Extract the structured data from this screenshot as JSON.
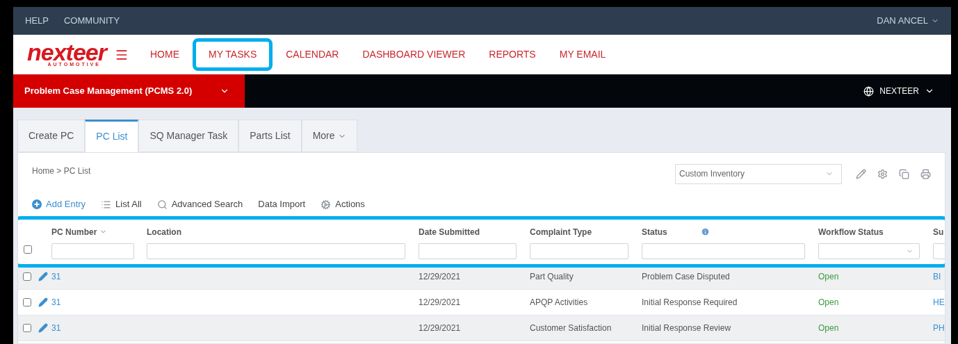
{
  "top_bar": {
    "links": [
      "HELP",
      "COMMUNITY"
    ],
    "user": "DAN ANCEL"
  },
  "logo": {
    "wordmark": "nexteer",
    "tagline": "AUTOMOTIVE"
  },
  "nav": [
    {
      "label": "HOME",
      "highlighted": false
    },
    {
      "label": "MY TASKS",
      "highlighted": true
    },
    {
      "label": "CALENDAR",
      "highlighted": false
    },
    {
      "label": "DASHBOARD VIEWER",
      "highlighted": false
    },
    {
      "label": "REPORTS",
      "highlighted": false
    },
    {
      "label": "MY EMAIL",
      "highlighted": false
    }
  ],
  "module_bar": {
    "title": "Problem Case Management (PCMS 2.0)",
    "org": "NEXTEER"
  },
  "tabs": [
    {
      "label": "Create PC",
      "selected": false,
      "kind": "tab"
    },
    {
      "label": "PC List",
      "selected": true,
      "kind": "tab"
    },
    {
      "label": "SQ Manager Task",
      "selected": false,
      "kind": "tab"
    },
    {
      "label": "Parts List",
      "selected": false,
      "kind": "tab"
    },
    {
      "label": "More",
      "selected": false,
      "kind": "dropdown"
    }
  ],
  "breadcrumb": "Home > PC List",
  "view_select": {
    "value": "Custom Inventory"
  },
  "toolbar": [
    {
      "label": "Add Entry",
      "kind": "add"
    },
    {
      "label": "List All",
      "kind": "list"
    },
    {
      "label": "Advanced Search",
      "kind": "search"
    },
    {
      "label": "Data Import",
      "kind": "plain"
    },
    {
      "label": "Actions",
      "kind": "actions"
    }
  ],
  "table": {
    "header_highlighted": true,
    "select_all_checked": false,
    "columns": [
      {
        "label": "PC Number",
        "kind": "text",
        "sort": true,
        "info": false
      },
      {
        "label": "Location",
        "kind": "text",
        "sort": false,
        "info": false
      },
      {
        "label": "Date Submitted",
        "kind": "text",
        "sort": false,
        "info": false
      },
      {
        "label": "Complaint Type",
        "kind": "text",
        "sort": false,
        "info": false
      },
      {
        "label": "Status",
        "kind": "text",
        "sort": false,
        "info": true
      },
      {
        "label": "Workflow Status",
        "kind": "select",
        "sort": false,
        "info": false
      },
      {
        "label": "Su",
        "kind": "text",
        "sort": false,
        "info": false
      }
    ],
    "rows": [
      {
        "checked": false,
        "cells": [
          "31",
          "",
          "12/29/2021",
          "Part Quality",
          "Problem Case Disputed",
          "Open",
          "BI"
        ]
      },
      {
        "checked": false,
        "cells": [
          "31",
          "",
          "12/29/2021",
          "APQP Activities",
          "Initial Response Required",
          "Open",
          "HE"
        ]
      },
      {
        "checked": false,
        "cells": [
          "31",
          "",
          "12/29/2021",
          "Customer Satisfaction",
          "Initial Response Review",
          "Open",
          "PH"
        ]
      }
    ]
  }
}
